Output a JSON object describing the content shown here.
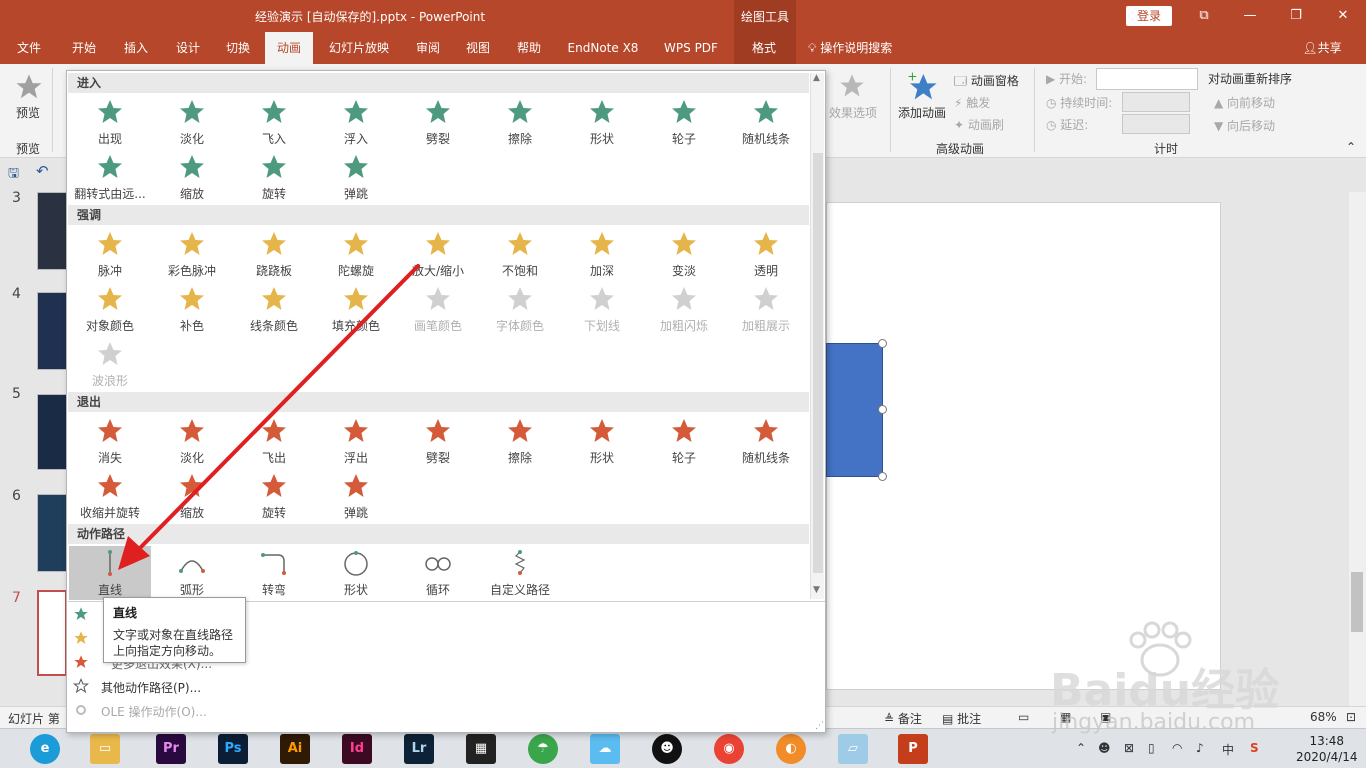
{
  "window": {
    "title": "经验演示 [自动保存的].pptx  -  PowerPoint",
    "drawing_tools": "绘图工具",
    "login": "登录"
  },
  "tabs": [
    "文件",
    "开始",
    "插入",
    "设计",
    "切换",
    "动画",
    "幻灯片放映",
    "审阅",
    "视图",
    "帮助",
    "EndNote X8",
    "WPS PDF",
    "格式"
  ],
  "tell_me": "操作说明搜索",
  "share": "共享",
  "ribbon": {
    "preview_label": "预览",
    "preview_group": "预览",
    "effect_options": "效果选项",
    "add_animation": "添加动画",
    "animation_pane": "动画窗格",
    "trigger": "触发",
    "animation_painter": "动画刷",
    "advanced_group": "高级动画",
    "start": "开始:",
    "duration": "持续时间:",
    "delay": "延迟:",
    "timing_group": "计时",
    "reorder_title": "对动画重新排序",
    "move_earlier": "向前移动",
    "move_later": "向后移动"
  },
  "gallery": {
    "sections": {
      "entrance": "进入",
      "emphasis": "强调",
      "exit": "退出",
      "motion": "动作路径"
    },
    "entrance": [
      "出现",
      "淡化",
      "飞入",
      "浮入",
      "劈裂",
      "擦除",
      "形状",
      "轮子",
      "随机线条",
      "翻转式由远...",
      "缩放",
      "旋转",
      "弹跳"
    ],
    "emphasis": [
      "脉冲",
      "彩色脉冲",
      "跷跷板",
      "陀螺旋",
      "放大/缩小",
      "不饱和",
      "加深",
      "变淡",
      "透明",
      "对象颜色",
      "补色",
      "线条颜色",
      "填充颜色",
      "画笔颜色",
      "字体颜色",
      "下划线",
      "加粗闪烁",
      "加粗展示",
      "波浪形"
    ],
    "exit": [
      "消失",
      "淡化",
      "飞出",
      "浮出",
      "劈裂",
      "擦除",
      "形状",
      "轮子",
      "随机线条",
      "收缩并旋转",
      "缩放",
      "旋转",
      "弹跳"
    ],
    "motion": [
      "直线",
      "弧形",
      "转弯",
      "形状",
      "循环",
      "自定义路径"
    ],
    "more_motion": "其他动作路径(P)...",
    "ole_action": "OLE 操作动作(O)...",
    "partial_menu": "更多退出效果(X)..."
  },
  "tooltip": {
    "title": "直线",
    "description": "文字或对象在直线路径上向指定方向移动。"
  },
  "slides": [
    "3",
    "4",
    "5",
    "6",
    "7"
  ],
  "status": {
    "slide_info": "幻灯片 第",
    "notes": "备注",
    "comments": "批注",
    "zoom": "68%"
  },
  "clock": {
    "time": "13:48",
    "date": "2020/4/14"
  },
  "taskbar": {
    "ime_lang": "中",
    "icons": [
      "Pr",
      "Ps",
      "Ai",
      "Id",
      "Lr"
    ]
  },
  "watermark": {
    "site": "jingyan.baidu.com",
    "brand": "Baidu",
    "brand_cn": "经验"
  },
  "colors": {
    "accent": "#b7472a",
    "entrance": "#4e9a7e",
    "emphasis": "#e6b54a",
    "exit": "#d45a3a",
    "selection": "#c9c9c9",
    "shape": "#4472c4",
    "arrow": "#e02020"
  }
}
